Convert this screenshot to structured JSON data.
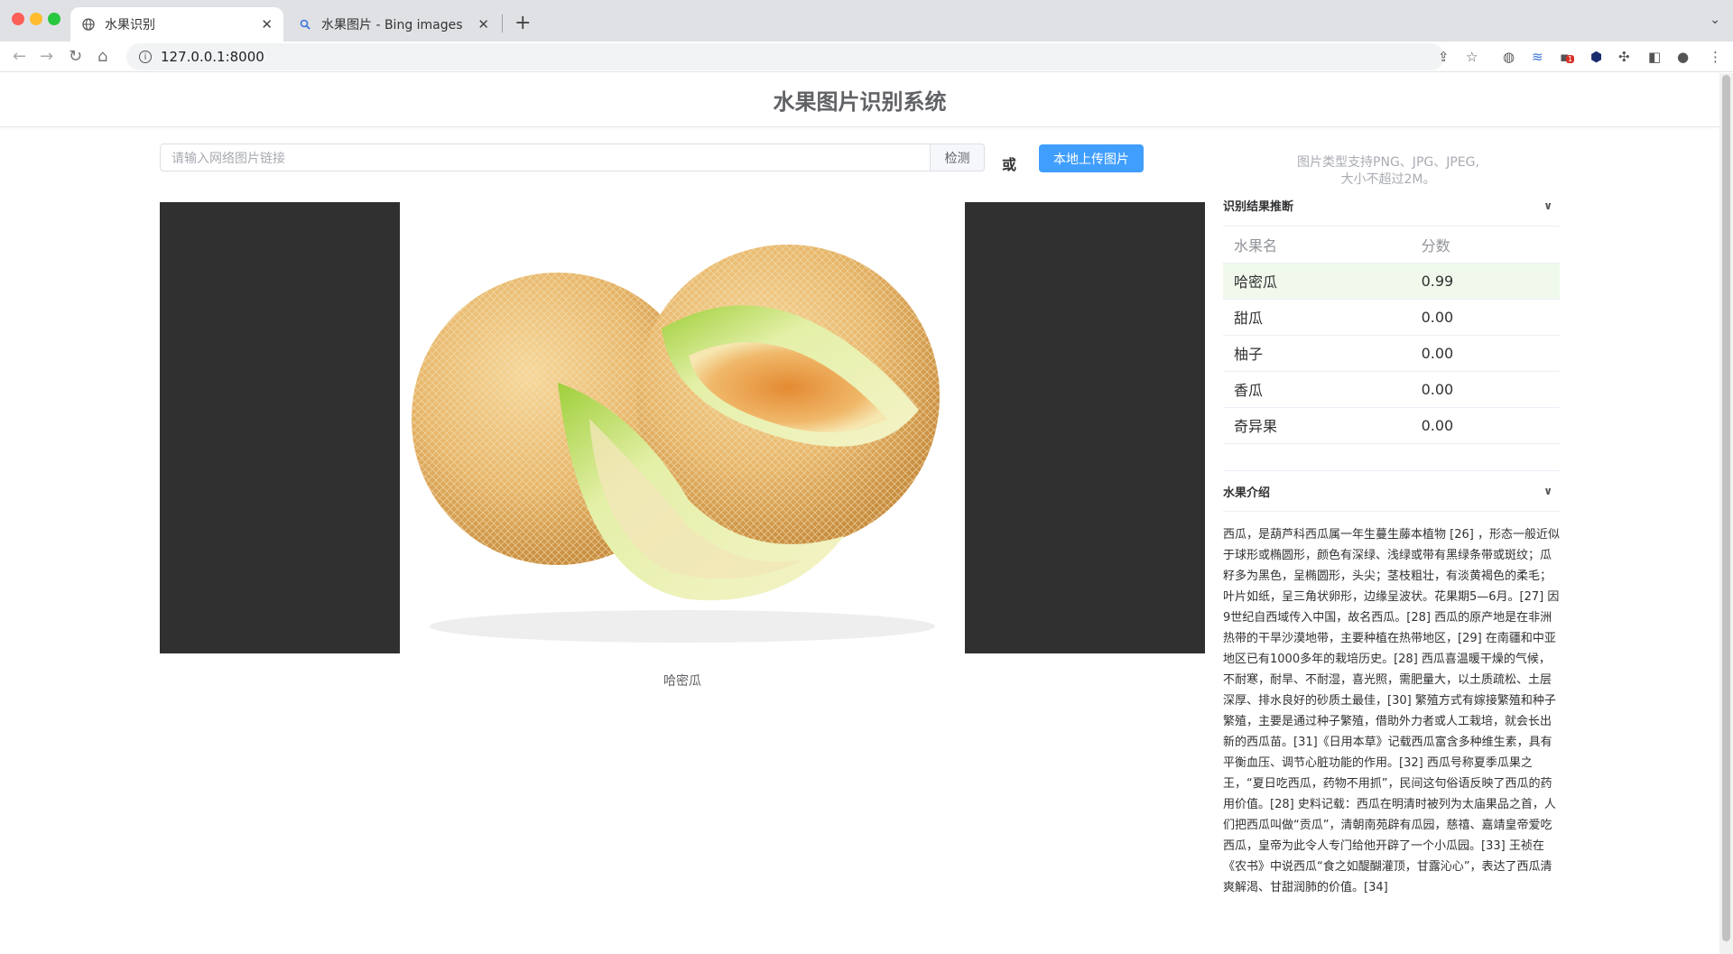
{
  "browser": {
    "tabs": [
      {
        "title": "水果识别",
        "icon": "globe-icon"
      },
      {
        "title": "水果图片 - Bing images",
        "icon": "bing-search-icon"
      }
    ],
    "url": "127.0.0.1:8000",
    "notification_badge": "1"
  },
  "page": {
    "title": "水果图片识别系统",
    "url_input_placeholder": "请输入网络图片链接",
    "detect_label": "检测",
    "or_label": "或",
    "upload_label": "本地上传图片",
    "hint_line1": "图片类型支持PNG、JPG、JPEG,",
    "hint_line2": "大小不超过2M。",
    "image_caption": "哈密瓜"
  },
  "results": {
    "title": "识别结果推断",
    "col_name": "水果名",
    "col_score": "分数",
    "rows": [
      {
        "name": "哈密瓜",
        "score": "0.99"
      },
      {
        "name": "甜瓜",
        "score": "0.00"
      },
      {
        "name": "柚子",
        "score": "0.00"
      },
      {
        "name": "香瓜",
        "score": "0.00"
      },
      {
        "name": "奇异果",
        "score": "0.00"
      }
    ]
  },
  "introduction": {
    "title": "水果介绍",
    "text": "西瓜，是葫芦科西瓜属一年生蔓生藤本植物 [26] ，形态一般近似于球形或椭圆形，颜色有深绿、浅绿或带有黑绿条带或斑纹；瓜籽多为黑色，呈椭圆形，头尖；茎枝粗壮，有淡黄褐色的柔毛；叶片如纸，呈三角状卵形，边缘呈波状。花果期5—6月。[27] 因9世纪自西域传入中国，故名西瓜。[28] 西瓜的原产地是在非洲热带的干旱沙漠地带，主要种植在热带地区，[29] 在南疆和中亚地区已有1000多年的栽培历史。[28] 西瓜喜温暖干燥的气候，不耐寒，耐旱、不耐湿，喜光照，需肥量大，以土质疏松、土层深厚、排水良好的砂质土最佳，[30] 繁殖方式有嫁接繁殖和种子繁殖，主要是通过种子繁殖，借助外力者或人工栽培，就会长出新的西瓜苗。[31]《日用本草》记载西瓜富含多种维生素，具有平衡血压、调节心脏功能的作用。[32] 西瓜号称夏季瓜果之王，“夏日吃西瓜，药物不用抓”，民间这句俗语反映了西瓜的药用价值。[28] 史料记载：西瓜在明清时被列为太庙果品之首，人们把西瓜叫做“贡瓜”，清朝南苑辟有瓜园，慈禧、嘉靖皇帝爱吃西瓜，皇帝为此令人专门给他开辟了一个小瓜园。[33] 王祯在《农书》中说西瓜“食之如醍醐灌顶，甘露沁心”，表达了西瓜清爽解渴、甘甜润肺的价值。[34]"
  },
  "colors": {
    "primary": "#409eff",
    "highlight_row": "#f0f9eb",
    "image_letterbox": "#303030"
  }
}
